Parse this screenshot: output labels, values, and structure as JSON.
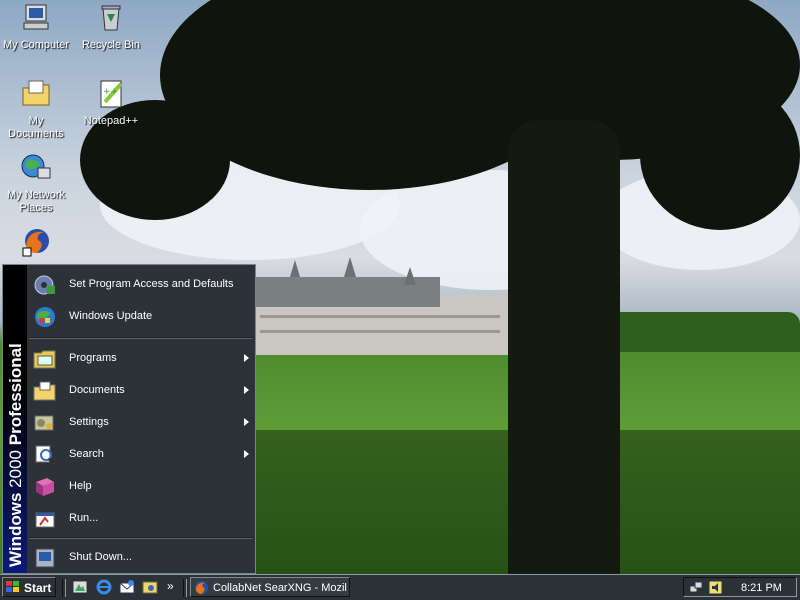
{
  "desktop": {
    "icons": [
      {
        "label": "My Computer",
        "icon": "computer-icon"
      },
      {
        "label": "Recycle Bin",
        "icon": "recycle-bin-icon"
      },
      {
        "label": "My Documents",
        "icon": "documents-folder-icon"
      },
      {
        "label": "Notepad++",
        "icon": "notepad-plus-plus-icon"
      },
      {
        "label": "My Network Places",
        "icon": "network-places-icon"
      },
      {
        "label": "",
        "icon": "firefox-shortcut-icon"
      }
    ]
  },
  "start_menu": {
    "banner_bold": "Windows",
    "banner_thin": "2000",
    "banner_suffix": "Professional",
    "items": [
      {
        "label": "Set Program Access and Defaults",
        "icon": "program-access-icon",
        "submenu": false
      },
      {
        "label": "Windows Update",
        "icon": "windows-update-icon",
        "submenu": false
      },
      {
        "label": "Programs",
        "icon": "programs-icon",
        "submenu": true
      },
      {
        "label": "Documents",
        "icon": "documents-icon",
        "submenu": true
      },
      {
        "label": "Settings",
        "icon": "settings-icon",
        "submenu": true
      },
      {
        "label": "Search",
        "icon": "search-icon",
        "submenu": true
      },
      {
        "label": "Help",
        "icon": "help-icon",
        "submenu": false
      },
      {
        "label": "Run...",
        "icon": "run-icon",
        "submenu": false
      },
      {
        "label": "Shut Down...",
        "icon": "shutdown-icon",
        "submenu": false
      }
    ]
  },
  "taskbar": {
    "start_label": "Start",
    "quick_launch": [
      "show-desktop-icon",
      "internet-explorer-icon",
      "outlook-express-icon",
      "media-icon"
    ],
    "chevron": "»",
    "task_label": "CollabNet SearXNG - Mozil...",
    "tray_icons": [
      "network-tray-icon",
      "volume-tray-icon"
    ],
    "clock": "8:21 PM"
  },
  "colors": {
    "menu_bg": "#2b3238",
    "taskbar_bg": "#2a3238",
    "banner_blue": "#0b1a7a",
    "text": "#ffffff"
  }
}
